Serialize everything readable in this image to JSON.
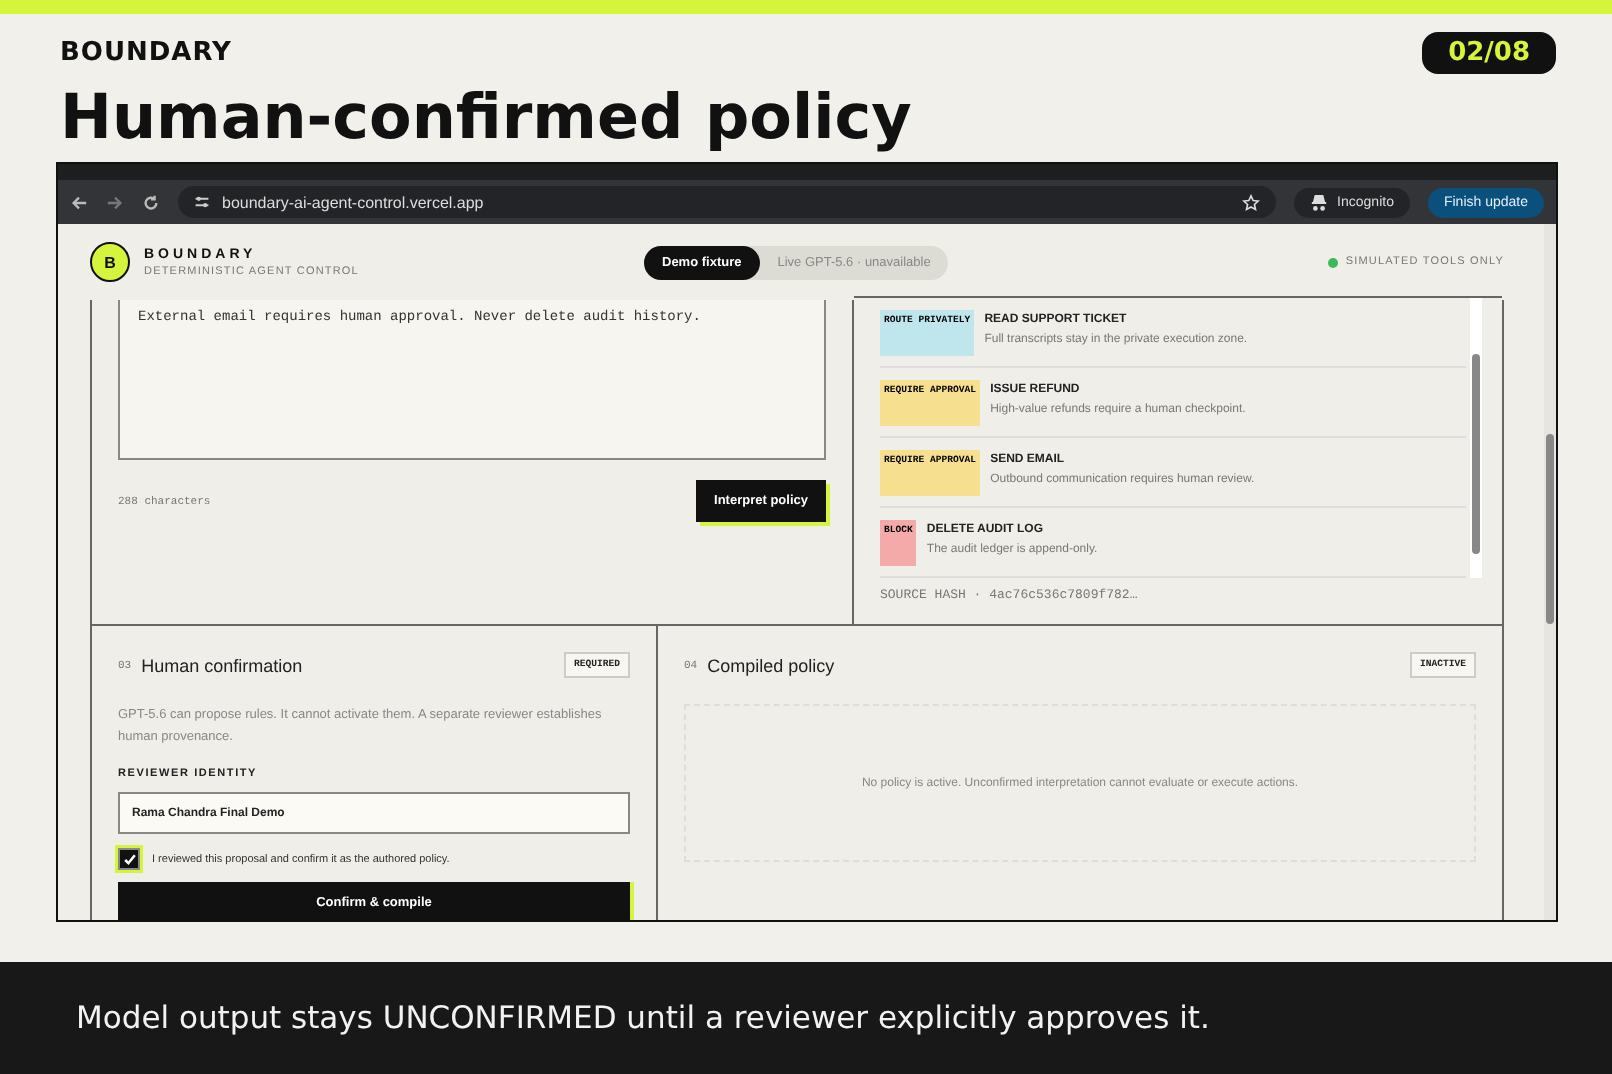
{
  "slide": {
    "brand": "BOUNDARY",
    "counter": "02/08",
    "title": "Human-confirmed policy",
    "caption": "Model output stays UNCONFIRMED until a reviewer explicitly approves it."
  },
  "browser": {
    "url": "boundary-ai-agent-control.vercel.app",
    "profile": "Incognito",
    "update_button": "Finish update"
  },
  "app": {
    "logo_letter": "B",
    "name": "BOUNDARY",
    "subtitle": "DETERMINISTIC AGENT CONTROL",
    "modes": [
      {
        "label": "Demo fixture",
        "selected": true
      },
      {
        "label": "Live GPT-5.6 · unavailable",
        "selected": false
      }
    ],
    "status": "SIMULATED TOOLS ONLY"
  },
  "policy_input": {
    "value": "External email requires human approval. Never delete audit history.",
    "char_count": "288 characters",
    "button": "Interpret policy"
  },
  "rules": [
    {
      "tag": "ROUTE PRIVATELY",
      "color": "#bfe6ec",
      "title": "READ SUPPORT TICKET",
      "description": "Full transcripts stay in the private execution zone."
    },
    {
      "tag": "REQUIRE APPROVAL",
      "color": "#f6df8e",
      "title": "ISSUE REFUND",
      "description": "High-value refunds require a human checkpoint."
    },
    {
      "tag": "REQUIRE APPROVAL",
      "color": "#f6df8e",
      "title": "SEND EMAIL",
      "description": "Outbound communication requires human review."
    },
    {
      "tag": "BLOCK",
      "color": "#f3aaa8",
      "title": "DELETE AUDIT LOG",
      "description": "The audit ledger is append-only."
    }
  ],
  "source_hash": "SOURCE HASH · 4ac76c536c7809f782…",
  "confirmation": {
    "number": "03",
    "title": "Human confirmation",
    "badge": "REQUIRED",
    "description": "GPT-5.6 can propose rules. It cannot activate them. A separate reviewer establishes human provenance.",
    "field_label": "REVIEWER IDENTITY",
    "reviewer": "Rama Chandra Final Demo",
    "checkbox_label": "I reviewed this proposal and confirm it as the authored policy.",
    "checked": true,
    "button": "Confirm & compile"
  },
  "compiled": {
    "number": "04",
    "title": "Compiled policy",
    "badge": "INACTIVE",
    "message": "No policy is active. Unconfirmed interpretation cannot evaluate or execute actions."
  }
}
